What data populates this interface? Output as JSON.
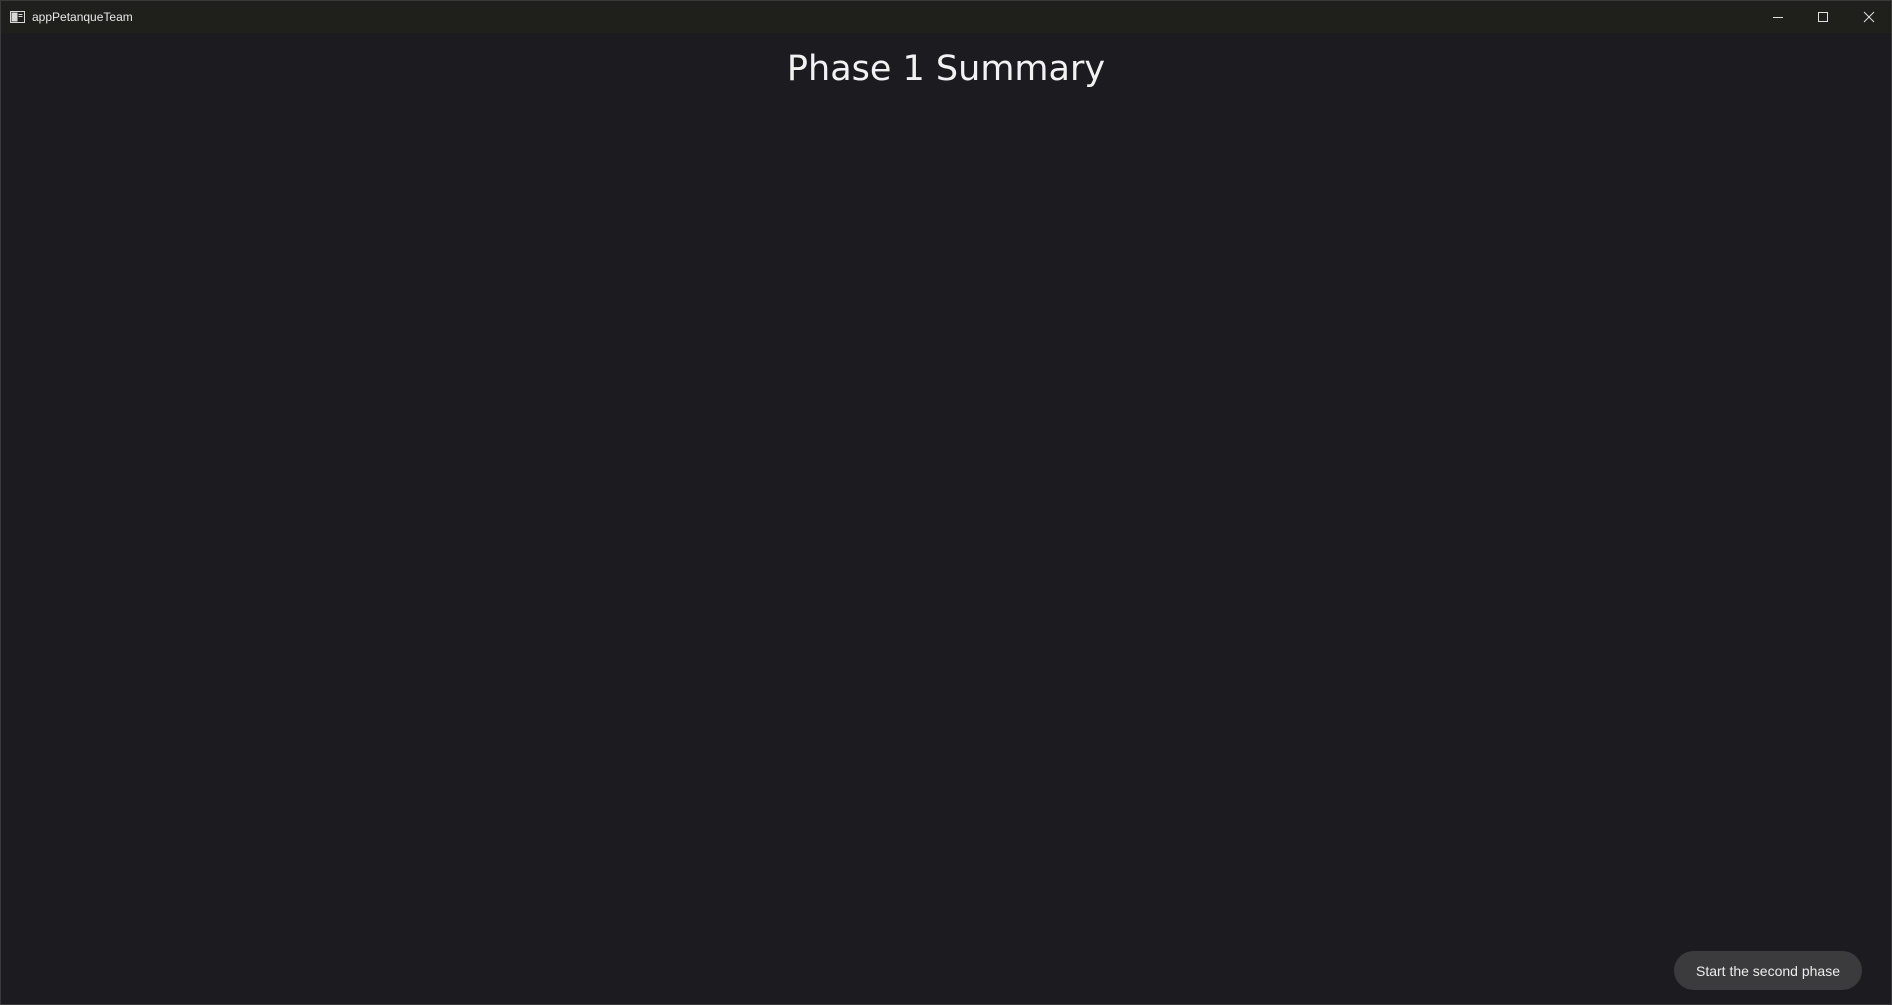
{
  "window": {
    "title": "appPetanqueTeam",
    "icon": "app-window-icon",
    "controls": {
      "minimize_icon": "minimize-icon",
      "maximize_icon": "maximize-icon",
      "close_icon": "close-icon"
    }
  },
  "main": {
    "title": "Phase 1 Summary",
    "action_button_label": "Start the second phase"
  },
  "colors": {
    "background": "#1c1c20",
    "titlebar": "#1f1f1b",
    "button_bg": "#3b3b3d",
    "text": "#f2f2f2"
  }
}
